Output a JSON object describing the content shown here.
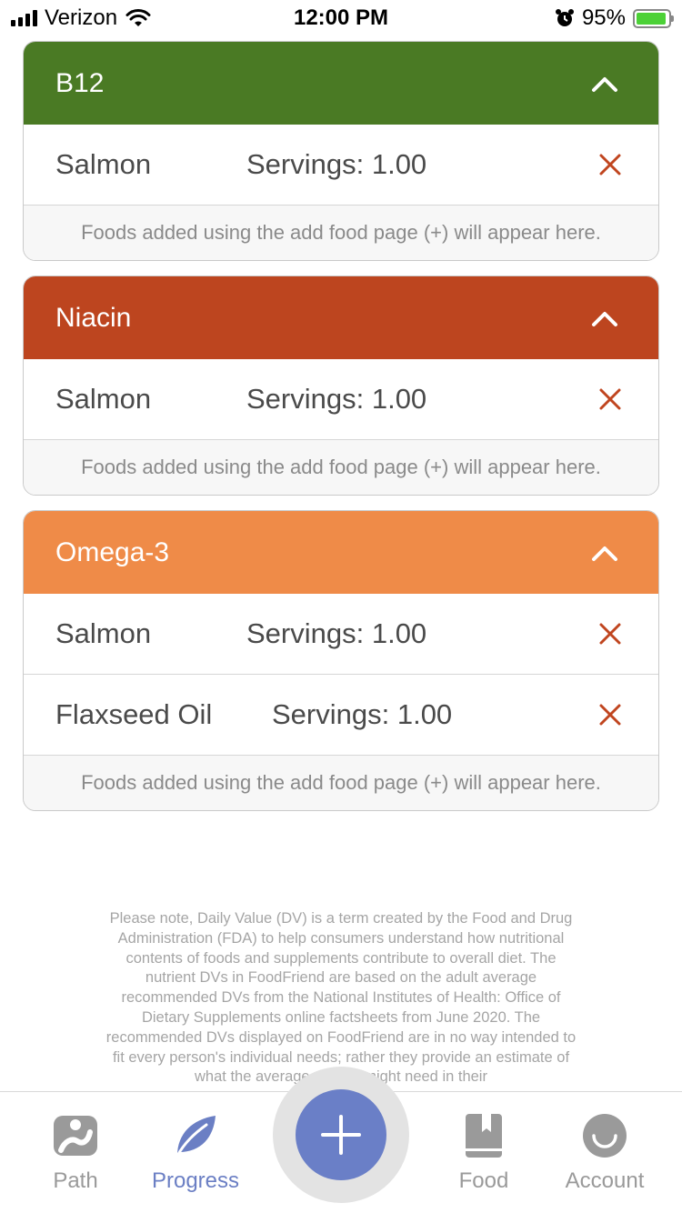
{
  "status_bar": {
    "carrier": "Verizon",
    "time": "12:00 PM",
    "battery": "95%",
    "battery_level": 0.95
  },
  "cards": [
    {
      "title": "B12",
      "color": "#4a7a24",
      "foods": [
        {
          "name": "Salmon",
          "servings": "Servings: 1.00"
        }
      ],
      "note": "Foods added using the add food page (+) will appear here."
    },
    {
      "title": "Niacin",
      "color": "#bd451f",
      "foods": [
        {
          "name": "Salmon",
          "servings": "Servings: 1.00"
        }
      ],
      "note": "Foods added using the add food page (+) will appear here."
    },
    {
      "title": "Omega-3",
      "color": "#ef8b48",
      "foods": [
        {
          "name": "Salmon",
          "servings": "Servings: 1.00"
        },
        {
          "name": "Flaxseed Oil",
          "servings": "Servings: 1.00"
        }
      ],
      "note": "Foods added using the add food page (+) will appear here."
    }
  ],
  "disclaimer": "Please note, Daily Value (DV) is a term created by the Food and Drug Administration (FDA) to help consumers understand how nutritional contents of foods and supplements contribute to overall diet. The nutrient DVs in FoodFriend are based on the adult average recommended DVs from the National Institutes of Health: Office of Dietary Supplements online factsheets from June 2020. The recommended DVs displayed on FoodFriend are in no way intended to fit every person's individual needs; rather they provide an estimate of what the average person might need in their",
  "tabs": {
    "path": "Path",
    "progress": "Progress",
    "food": "Food",
    "account": "Account"
  },
  "colors": {
    "accent": "#6a7fc7",
    "remove": "#c0451f",
    "inactive": "#9a9a9a"
  },
  "icons": {
    "path": "path-icon",
    "progress": "leaf-icon",
    "add": "plus-icon",
    "food": "book-icon",
    "account": "smiley-icon"
  }
}
